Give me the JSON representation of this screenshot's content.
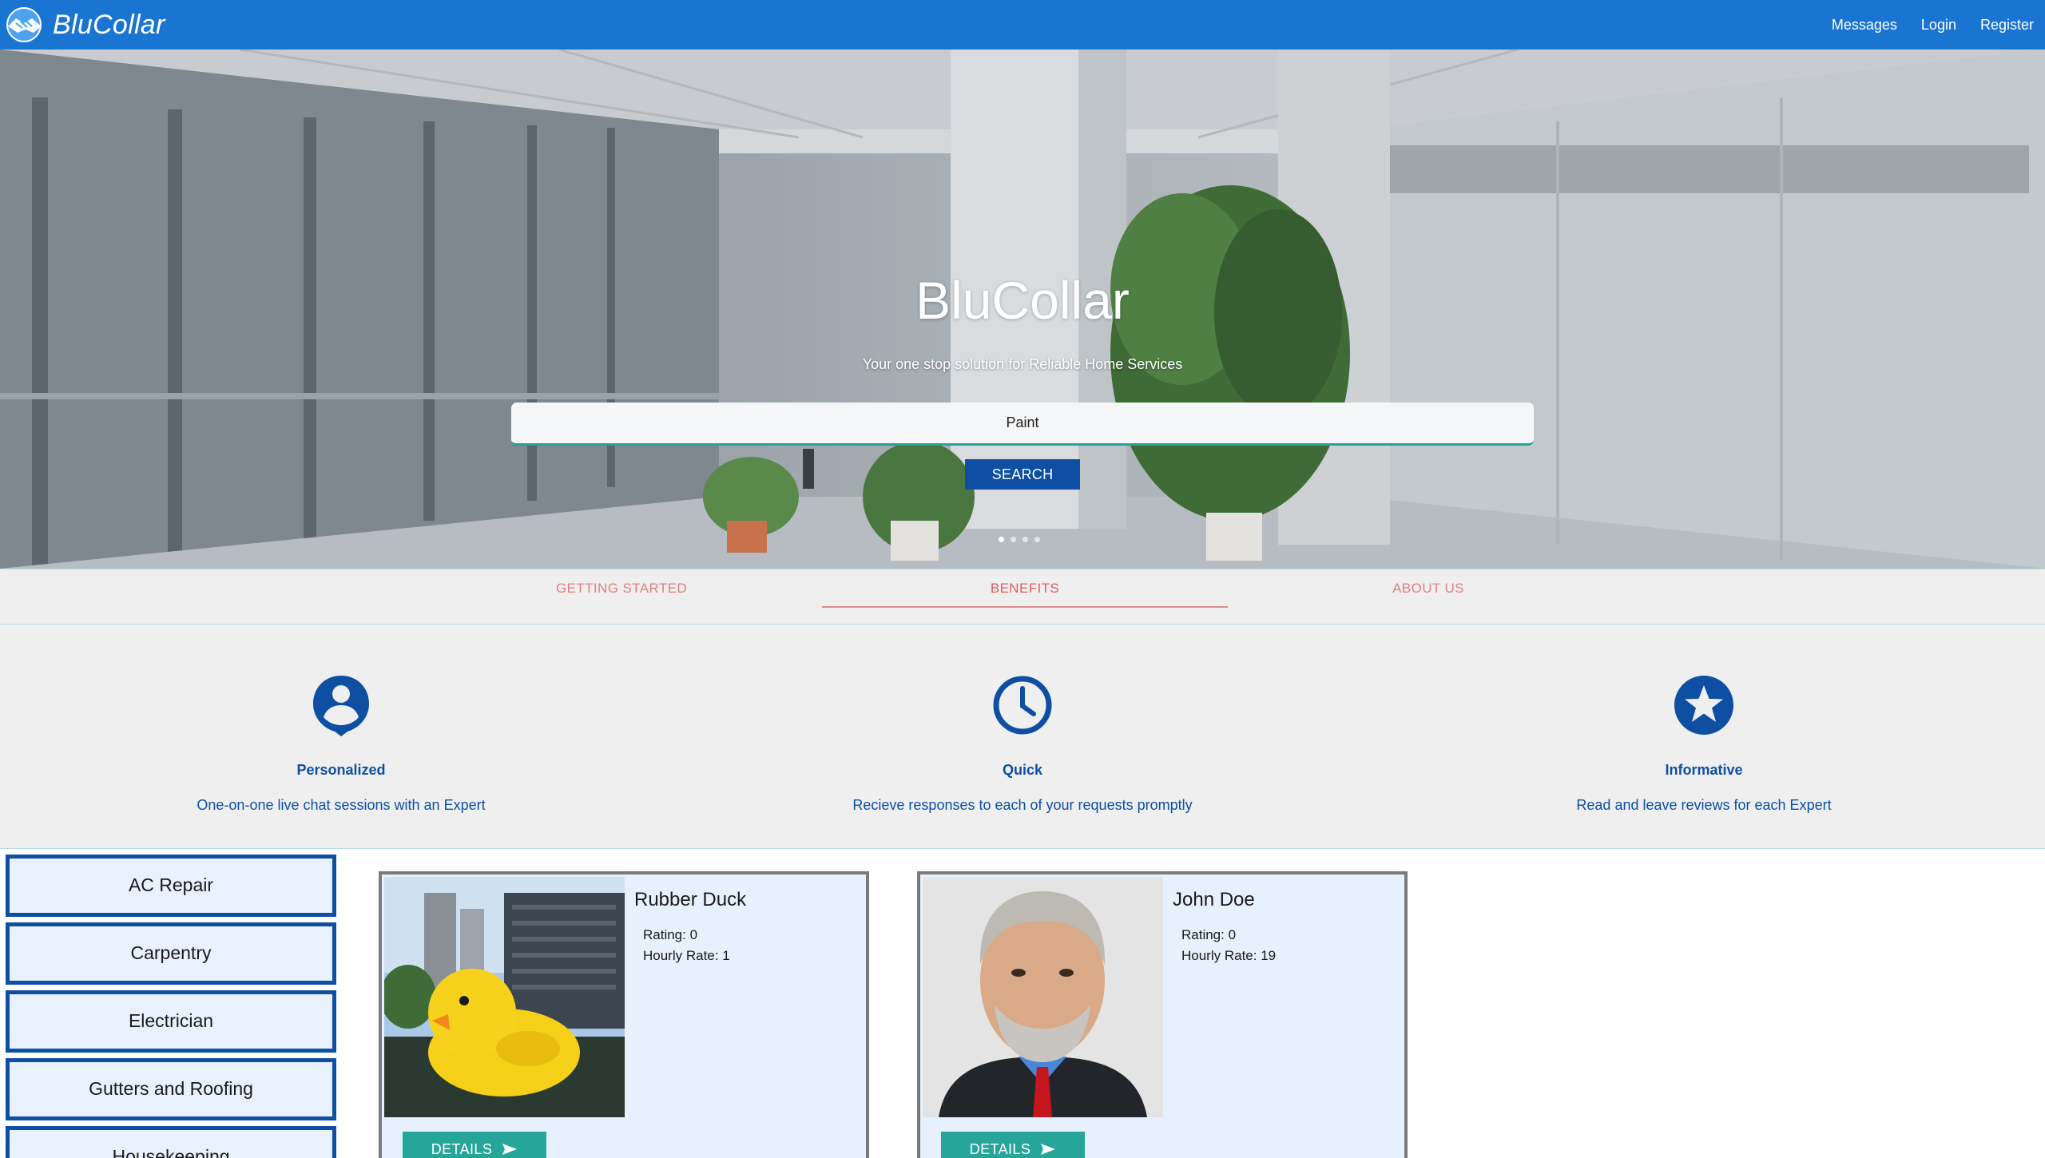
{
  "nav": {
    "brand": "BluCollar",
    "links": [
      "Messages",
      "Login",
      "Register"
    ]
  },
  "hero": {
    "title": "BluCollar",
    "subtitle": "Your one stop solution for Reliable Home Services",
    "search_value": "Paint",
    "search_button": "SEARCH",
    "slides": 4,
    "active_slide": 1
  },
  "tabs": {
    "items": [
      "GETTING STARTED",
      "BENEFITS",
      "ABOUT US"
    ],
    "active": "BENEFITS"
  },
  "benefits": [
    {
      "icon": "person-pin-icon",
      "title": "Personalized",
      "description": "One-on-one live chat sessions with an Expert"
    },
    {
      "icon": "clock-icon",
      "title": "Quick",
      "description": "Recieve responses to each of your requests promptly"
    },
    {
      "icon": "star-icon",
      "title": "Informative",
      "description": "Read and leave reviews for each Expert"
    }
  ],
  "categories": [
    "AC Repair",
    "Carpentry",
    "Electrician",
    "Gutters and Roofing",
    "Housekeeping"
  ],
  "experts": [
    {
      "name": "Rubber Duck",
      "rating": "Rating: 0",
      "hourly_rate": "Hourly Rate: 1",
      "photo": "rubber-duck-photo",
      "button": "DETAILS"
    },
    {
      "name": "John Doe",
      "rating": "Rating: 0",
      "hourly_rate": "Hourly Rate: 19",
      "photo": "man-portrait-photo",
      "button": "DETAILS"
    }
  ],
  "colors": {
    "navbar": "#1a75d2",
    "primary": "#0e4fa3",
    "accent_teal": "#26a69a",
    "tab_text": "#e08080",
    "card_bg": "#e6f1fd"
  }
}
